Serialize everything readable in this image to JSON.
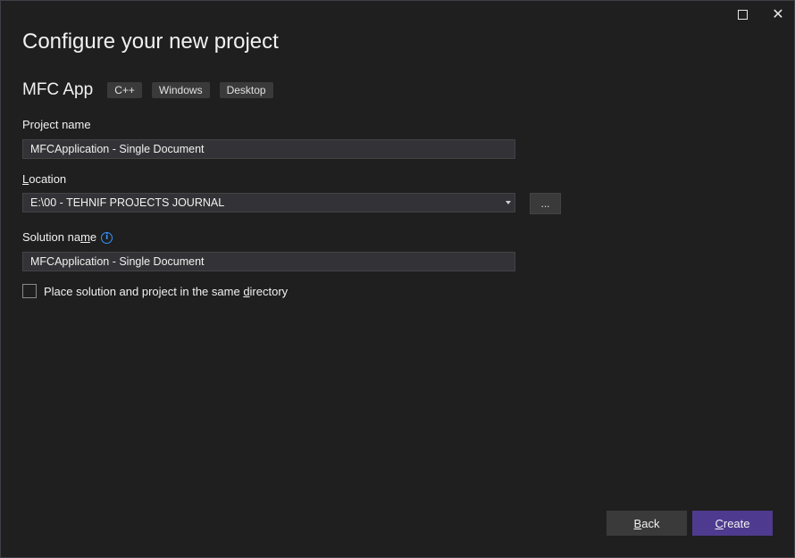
{
  "title": "Configure your new project",
  "template": {
    "name": "MFC App",
    "tags": [
      "C++",
      "Windows",
      "Desktop"
    ]
  },
  "project_name": {
    "label": "Project name",
    "value": "MFCApplication - Single Document"
  },
  "location": {
    "label_pre": "",
    "label_accel": "L",
    "label_post": "ocation",
    "value": "E:\\00 - TEHNIF PROJECTS JOURNAL",
    "browse_label": "..."
  },
  "solution_name": {
    "label_pre": "Solution na",
    "label_accel": "m",
    "label_post": "e",
    "value": "MFCApplication - Single Document"
  },
  "same_directory": {
    "label_pre": "Place solution and project in the same ",
    "label_accel": "d",
    "label_post": "irectory",
    "checked": false
  },
  "buttons": {
    "back_accel": "B",
    "back_rest": "ack",
    "create_accel": "C",
    "create_rest": "reate"
  },
  "colors": {
    "background": "#1f1f1f",
    "field": "#333337",
    "accent": "#4e3b8f",
    "info": "#3794ff"
  }
}
